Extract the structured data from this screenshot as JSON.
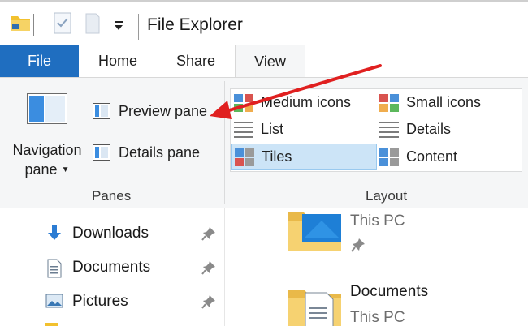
{
  "window": {
    "title": "File Explorer"
  },
  "quick_access": {
    "folder_icon": "folder-icon",
    "properties_icon": "properties-icon",
    "new_folder_icon": "new-folder-icon",
    "customize_icon": "chevron-down-icon"
  },
  "tabs": [
    {
      "label": "File",
      "active": false
    },
    {
      "label": "Home",
      "active": false
    },
    {
      "label": "Share",
      "active": false
    },
    {
      "label": "View",
      "active": true
    }
  ],
  "ribbon": {
    "panes": {
      "group_label": "Panes",
      "navigation_pane": {
        "line1": "Navigation",
        "line2": "pane",
        "icon": "navigation-pane-icon"
      },
      "preview_pane": {
        "label": "Preview pane",
        "icon": "preview-pane-icon"
      },
      "details_pane": {
        "label": "Details pane",
        "icon": "details-pane-icon"
      }
    },
    "layout": {
      "group_label": "Layout",
      "items": [
        {
          "label": "Medium icons",
          "icon": "medium-icons-icon"
        },
        {
          "label": "Small icons",
          "icon": "small-icons-icon"
        },
        {
          "label": "List",
          "icon": "list-icon"
        },
        {
          "label": "Details",
          "icon": "details-icon"
        },
        {
          "label": "Tiles",
          "icon": "tiles-icon",
          "selected": true
        },
        {
          "label": "Content",
          "icon": "content-icon"
        }
      ]
    }
  },
  "nav_pane": {
    "items": [
      {
        "label": "Downloads",
        "icon": "download-icon",
        "pinned": true
      },
      {
        "label": "Documents",
        "icon": "document-icon",
        "pinned": true
      },
      {
        "label": "Pictures",
        "icon": "pictures-icon",
        "pinned": true
      }
    ]
  },
  "files": [
    {
      "name": "",
      "location": "This PC",
      "icon": "desktop-folder-icon",
      "pinned": true
    },
    {
      "name": "Documents",
      "location": "This PC",
      "icon": "documents-folder-icon"
    }
  ],
  "colors": {
    "accent": "#1f6ec0",
    "selection": "#cce4f7",
    "annotation_arrow": "#e02020"
  }
}
